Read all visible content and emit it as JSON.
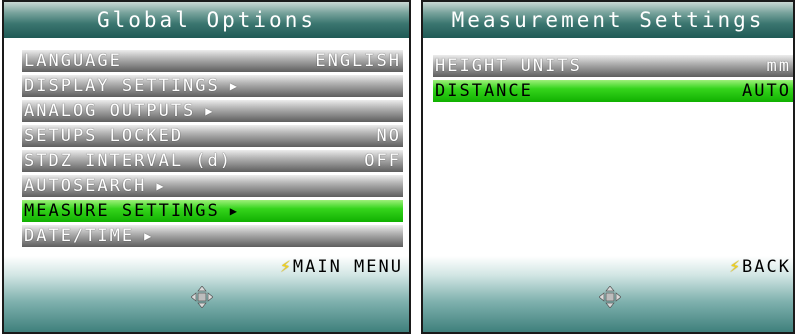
{
  "global_options": {
    "title": "Global Options",
    "items": [
      {
        "label": "LANGUAGE",
        "value": "ENGLISH",
        "arrow": false,
        "selected": false
      },
      {
        "label": "DISPLAY SETTINGS",
        "value": "",
        "arrow": true,
        "selected": false
      },
      {
        "label": "ANALOG OUTPUTS",
        "value": "",
        "arrow": true,
        "selected": false
      },
      {
        "label": "SETUPS LOCKED",
        "value": "NO",
        "arrow": false,
        "selected": false
      },
      {
        "label": "STDZ INTERVAL (d)",
        "value": "OFF",
        "arrow": false,
        "selected": false
      },
      {
        "label": "AUTOSEARCH",
        "value": "",
        "arrow": true,
        "selected": false
      },
      {
        "label": "MEASURE SETTINGS",
        "value": "",
        "arrow": true,
        "selected": true
      },
      {
        "label": "DATE/TIME",
        "value": "",
        "arrow": true,
        "selected": false
      }
    ],
    "softkey_label": "MAIN MENU"
  },
  "measurement_settings": {
    "title": "Measurement Settings",
    "items": [
      {
        "label": "HEIGHT UNITS",
        "value": "mm",
        "arrow": false,
        "selected": false
      },
      {
        "label": "DISTANCE",
        "value": "AUTO",
        "arrow": false,
        "selected": true
      }
    ],
    "softkey_label": "BACK"
  },
  "icons": {
    "arrow": "right-triangle-icon",
    "softkey": "lightning-bolt-icon",
    "nav": "four-way-dpad-icon"
  },
  "colors": {
    "selected_highlight": "#22c40a",
    "title_bar": "#2f6f6a",
    "softkey_bolt": "#f3d11a"
  }
}
